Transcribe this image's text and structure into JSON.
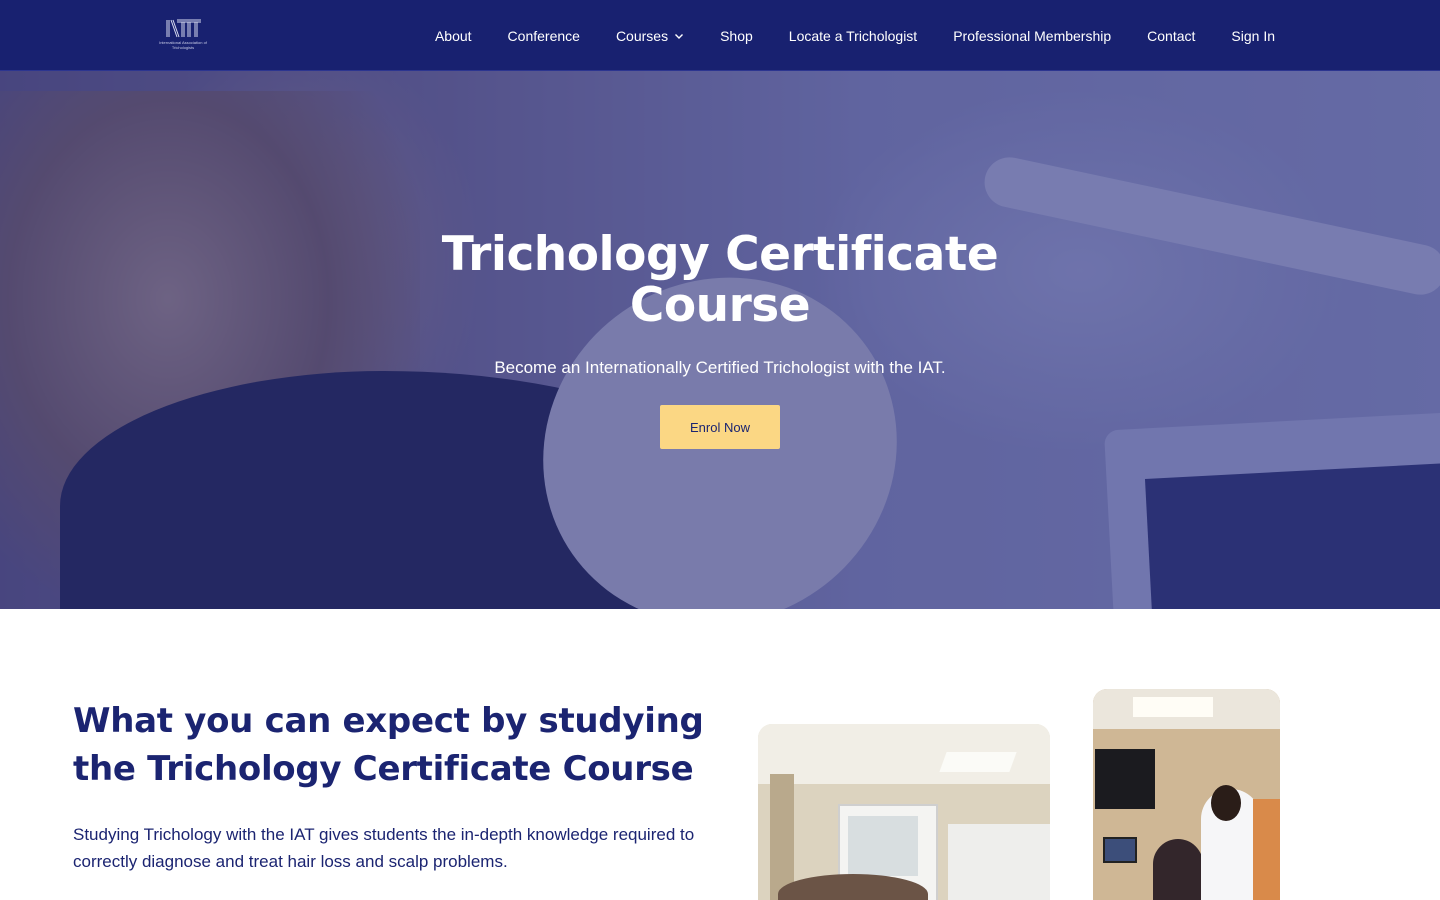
{
  "header": {
    "logo_text": "International Association of Trichologists",
    "nav": [
      {
        "label": "About"
      },
      {
        "label": "Conference"
      },
      {
        "label": "Courses",
        "has_dropdown": true
      },
      {
        "label": "Shop"
      },
      {
        "label": "Locate a Trichologist"
      },
      {
        "label": "Professional Membership"
      },
      {
        "label": "Contact"
      },
      {
        "label": "Sign In"
      }
    ]
  },
  "hero": {
    "title": "Trichology Certificate Course",
    "subtitle": "Become an Internationally Certified Trichologist with the IAT.",
    "cta_label": "Enrol Now"
  },
  "section": {
    "title": "What you can expect by studying the Trichology Certificate Course",
    "text": "Studying Trichology with the IAT gives students the in-depth knowledge required to correctly diagnose and treat hair loss and scalp problems."
  },
  "colors": {
    "header_bg": "#182170",
    "hero_overlay": "#202880",
    "cta_bg": "#fbd784",
    "heading_text": "#1b2471"
  }
}
